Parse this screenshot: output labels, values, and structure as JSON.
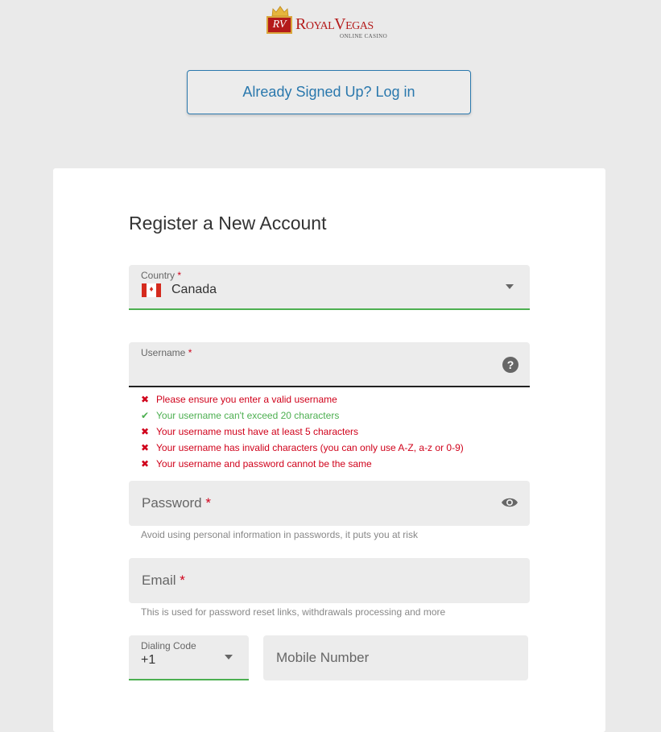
{
  "brand": {
    "badge": "RV",
    "name": "RoyalVegas",
    "tagline": "ONLINE CASINO",
    "color": "#b41a1a"
  },
  "login_button": {
    "label": "Already Signed Up? Log in",
    "color": "#2a78ad"
  },
  "form": {
    "title": "Register a New Account",
    "required_marker": "*",
    "country": {
      "label": "Country",
      "value": "Canada",
      "flag_icon": "canada-flag-icon",
      "status_color": "#4caf50"
    },
    "username": {
      "label": "Username",
      "value": "",
      "help_icon": "question-circle-icon",
      "rules": [
        {
          "text": "Please ensure you enter a valid username",
          "status": "fail",
          "mark": "✖"
        },
        {
          "text": "Your username can't exceed 20 characters",
          "status": "pass",
          "mark": "✔"
        },
        {
          "text": "Your username must have at least 5 characters",
          "status": "fail",
          "mark": "✖"
        },
        {
          "text": "Your username has invalid characters (you can only use A-Z, a-z or 0-9)",
          "status": "fail",
          "mark": "✖"
        },
        {
          "text": "Your username and password cannot be the same",
          "status": "fail",
          "mark": "✖"
        }
      ]
    },
    "password": {
      "label": "Password",
      "value": "",
      "visibility_icon": "eye-icon",
      "hint": "Avoid using personal information in passwords, it puts you at risk"
    },
    "email": {
      "label": "Email",
      "value": "",
      "hint": "This is used for password reset links, withdrawals processing and more"
    },
    "dialing_code": {
      "label": "Dialing Code",
      "value": "+1"
    },
    "mobile": {
      "placeholder": "Mobile Number",
      "value": ""
    }
  },
  "colors": {
    "error": "#d0021b",
    "success": "#4caf50",
    "field_bg": "#ececec",
    "page_bg": "#eaeaea"
  }
}
